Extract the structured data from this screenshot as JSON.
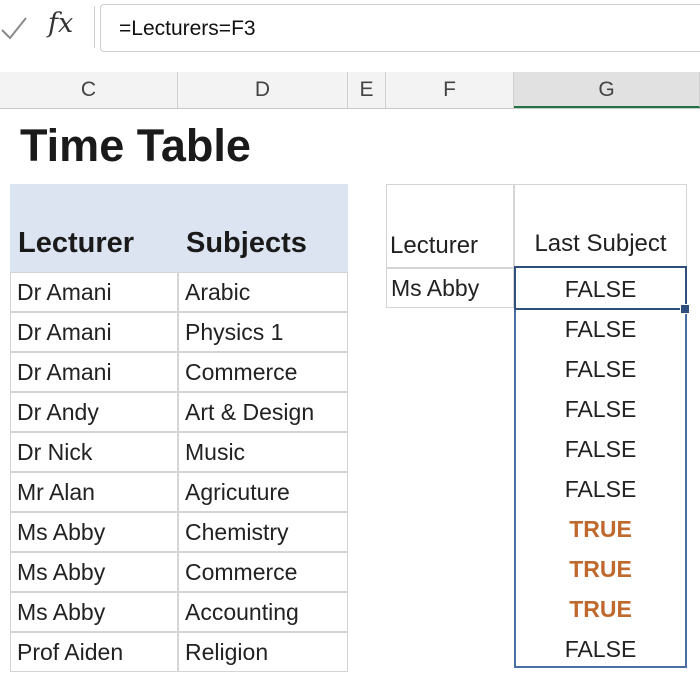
{
  "formula_bar": {
    "fx_label": "fx",
    "formula": "=Lecturers=F3"
  },
  "columns": {
    "c": "C",
    "d": "D",
    "e": "E",
    "f": "F",
    "g": "G"
  },
  "sheet": {
    "title": "Time Table",
    "table": {
      "headers": [
        "Lecturer",
        "Subjects"
      ],
      "rows": [
        [
          "Dr Amani",
          "Arabic"
        ],
        [
          "Dr Amani",
          "Physics 1"
        ],
        [
          "Dr Amani",
          "Commerce"
        ],
        [
          "Dr Andy",
          "Art & Design"
        ],
        [
          "Dr Nick",
          "Music"
        ],
        [
          "Mr Alan",
          "Agricuture"
        ],
        [
          "Ms Abby",
          "Chemistry"
        ],
        [
          "Ms Abby",
          "Commerce"
        ],
        [
          "Ms Abby",
          "Accounting"
        ],
        [
          "Prof Aiden",
          "Religion"
        ]
      ]
    },
    "lookup": {
      "lecturer_header": "Lecturer",
      "lecturer_value": "Ms Abby",
      "result_header": "Last Subject",
      "results": [
        "FALSE",
        "FALSE",
        "FALSE",
        "FALSE",
        "FALSE",
        "FALSE",
        "TRUE",
        "TRUE",
        "TRUE",
        "FALSE"
      ]
    }
  },
  "colors": {
    "true_text": "#c0692f",
    "header_fill": "#dbe4f0",
    "selection_border": "#2f4f7f"
  }
}
